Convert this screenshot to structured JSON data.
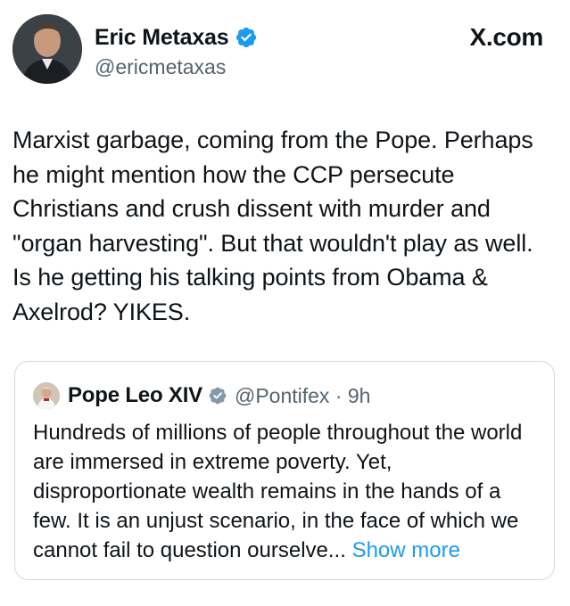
{
  "post": {
    "author": {
      "display_name": "Eric Metaxas",
      "handle": "@ericmetaxas",
      "verified": true
    },
    "source_logo": "X.com",
    "text": "Marxist garbage, coming from the Pope. Perhaps he might mention how the CCP persecute Christians and crush dissent with murder and \"organ harvesting\". But that wouldn't play as well. Is he getting his talking points from Obama & Axelrod? YIKES."
  },
  "quote": {
    "author": {
      "display_name": "Pope Leo XIV",
      "handle": "@Pontifex",
      "separator": "·",
      "time": "9h",
      "verified": true
    },
    "text": "Hundreds of millions of people throughout the world are immersed in extreme poverty. Yet, disproportionate wealth remains in the hands of a few. It is an unjust scenario, in the face of which we cannot fail to question ourselve...",
    "show_more_label": "Show more"
  },
  "colors": {
    "text": "#0f1419",
    "secondary": "#536471",
    "link": "#1d9bf0",
    "verified_badge": "#1d9bf0",
    "quote_verified_badge": "#829aab",
    "border": "#cfd9de"
  },
  "icons": {
    "verified": "verified-badge-icon",
    "quote_verified": "gray-verified-badge-icon"
  }
}
